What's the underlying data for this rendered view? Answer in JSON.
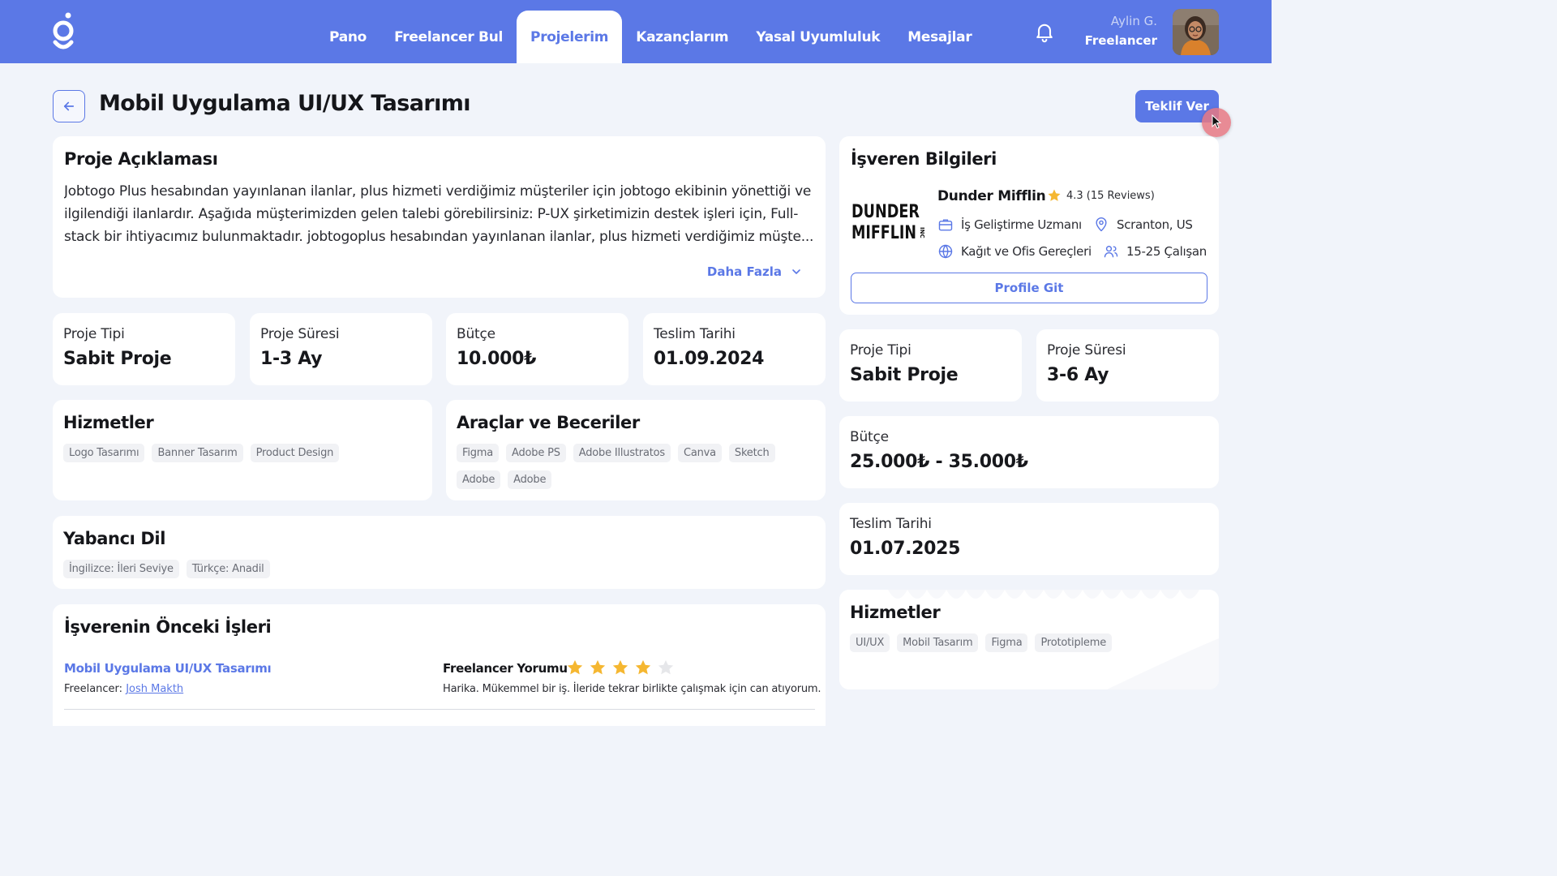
{
  "nav": {
    "items": [
      {
        "label": "Pano",
        "active": false
      },
      {
        "label": "Freelancer Bul",
        "active": false
      },
      {
        "label": "Projelerim",
        "active": true
      },
      {
        "label": "Kazançlarım",
        "active": false
      },
      {
        "label": "Yasal Uyumluluk",
        "active": false
      },
      {
        "label": "Mesajlar",
        "active": false
      }
    ],
    "user_name": "Aylin G.",
    "user_role": "Freelancer"
  },
  "header": {
    "title": "Mobil Uygulama UI/UX Tasarımı",
    "offer_button": "Teklif Ver"
  },
  "description": {
    "title": "Proje Açıklaması",
    "text": "Jobtogo Plus hesabından yayınlanan ilanlar, plus hizmeti verdiğimiz müşteriler için jobtogo ekibinin yönettiği ve ilgilendiği ilanlardır. Aşağıda müşterimizden gelen talebi görebilirsiniz: P-UX şirketimizin destek işleri için, Full-stack bir ihtiyacımız bulunmaktadır. jobtogoplus hesabından yayınlanan ilanlar, plus hizmeti verdiğimiz müşte...",
    "more": "Daha Fazla"
  },
  "stats": [
    {
      "label": "Proje Tipi",
      "value": "Sabit Proje"
    },
    {
      "label": "Proje Süresi",
      "value": "1-3 Ay"
    },
    {
      "label": "Bütçe",
      "value": "10.000₺"
    },
    {
      "label": "Teslim Tarihi",
      "value": "01.09.2024"
    }
  ],
  "services": {
    "title": "Hizmetler",
    "chips": [
      "Logo Tasarımı",
      "Banner Tasarım",
      "Product Design"
    ]
  },
  "skills": {
    "title": "Araçlar ve Beceriler",
    "chips": [
      "Figma",
      "Adobe PS",
      "Adobe Illustratos",
      "Canva",
      "Sketch",
      "Adobe",
      "Adobe"
    ]
  },
  "languages": {
    "title": "Yabancı Dil",
    "chips": [
      "İngilizce: İleri Seviye",
      "Türkçe: Anadil"
    ]
  },
  "previous_work": {
    "title": "İşverenin Önceki İşleri",
    "item": {
      "project": "Mobil Uygulama UI/UX Tasarımı",
      "freelancer_label": "Freelancer:",
      "freelancer_name": "Josh Makth",
      "review_label": "Freelancer Yorumu",
      "rating": 4,
      "rating_max": 5,
      "review": "Harika. Mükemmel bir iş. İleride tekrar birlikte çalışmak için can atıyorum."
    }
  },
  "employer": {
    "title": "İşveren Bilgileri",
    "logo_text": [
      "DUNDER",
      "MIFFLIN",
      "INC"
    ],
    "company": "Dunder Mifflin",
    "rating": "4.3 (15 Reviews)",
    "job_title": "İş Geliştirme Uzmanı",
    "location": "Scranton, US",
    "industry": "Kağıt ve Ofis Gereçleri",
    "size": "15-25 Çalışan",
    "profile_button": "Profile Git"
  },
  "right_stats": [
    {
      "label": "Proje Tipi",
      "value": "Sabit Proje"
    },
    {
      "label": "Proje Süresi",
      "value": "3-6 Ay"
    },
    {
      "label": "Bütçe",
      "value": "25.000₺ - 35.000₺"
    },
    {
      "label": "Teslim Tarihi",
      "value": "01.07.2025"
    }
  ],
  "right_services": {
    "title": "Hizmetler",
    "chips": [
      "UI/UX",
      "Mobil Tasarım",
      "Figma",
      "Prototipleme"
    ]
  },
  "colors": {
    "primary": "#5b78e6",
    "background": "#f1f4fa",
    "star": "#f5b731",
    "star_empty": "#e6e7ea"
  }
}
